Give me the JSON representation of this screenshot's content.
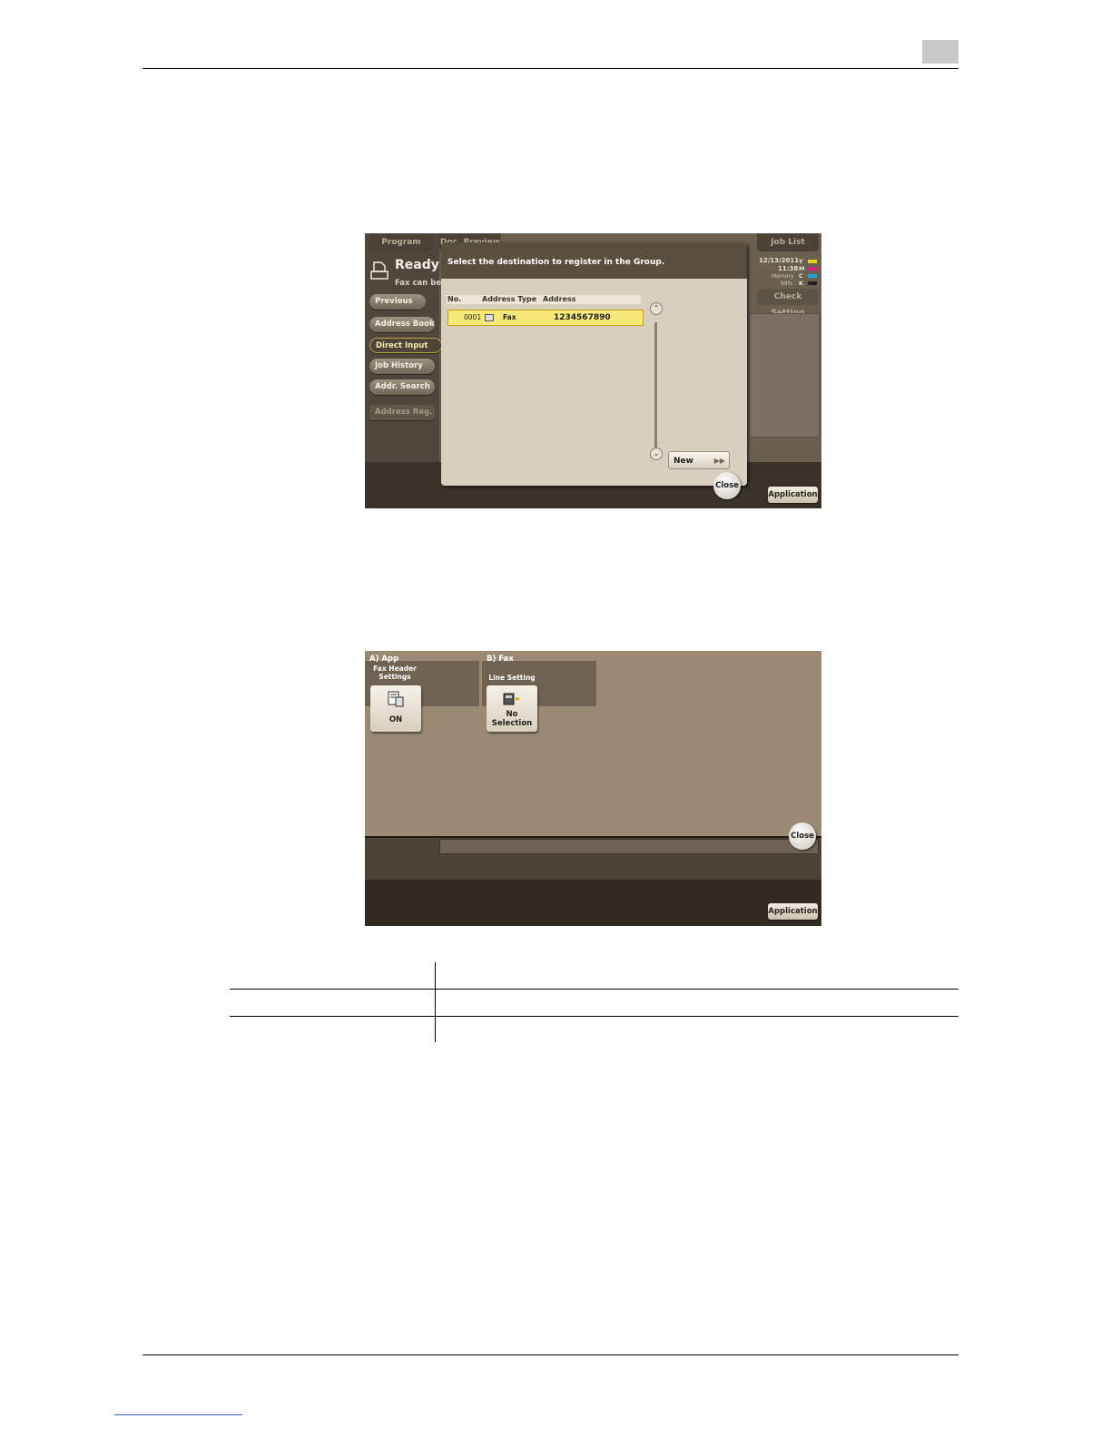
{
  "screen1": {
    "tabs": {
      "program": "Program",
      "doc_preview": "Doc. Preview",
      "job_list": "Job List"
    },
    "status": {
      "title": "Ready t",
      "subtitle": "Fax can be s"
    },
    "side_buttons": [
      "Previous",
      "Address Book",
      "Direct Input",
      "Job History",
      "Addr. Search",
      "Address Reg."
    ],
    "clock": {
      "date": "12/13/2011",
      "time": "11:38",
      "memory_label": "Memory",
      "memory_value": "99%"
    },
    "toner": [
      "Y",
      "M",
      "C",
      "K"
    ],
    "check_setting": "Check Setting",
    "dialog": {
      "title": "Select the destination to register in the Group.",
      "columns": {
        "no": "No.",
        "type": "Address Type",
        "address": "Address"
      },
      "row": {
        "no": "0001",
        "type": "Fax",
        "address": "1234567890"
      },
      "new_button": "New",
      "close": "Close"
    },
    "application": "Application"
  },
  "screen2": {
    "panel_a": {
      "label": "A)   App",
      "sub": "Fax Header Settings",
      "value": "ON"
    },
    "panel_b": {
      "label": "B)   Fax",
      "sub": "Line Setting",
      "value_line1": "No",
      "value_line2": "Selection"
    },
    "close": "Close",
    "application": "Application"
  },
  "colors": {
    "toner_y": "#e8d21a",
    "toner_m": "#d2238a",
    "toner_c": "#1fa3d8",
    "toner_k": "#222222",
    "highlight": "#f7e87a"
  }
}
